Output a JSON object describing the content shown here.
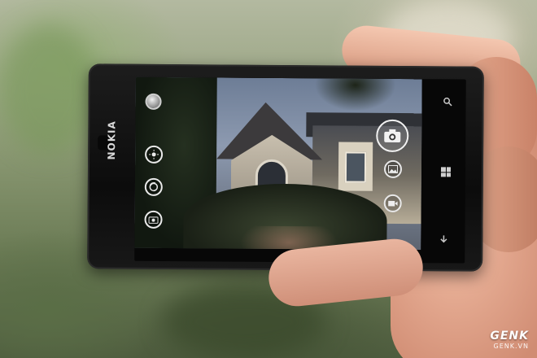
{
  "phone": {
    "brand": "NOKIA"
  },
  "camera_ui": {
    "left_controls": [
      {
        "name": "flash-indicator",
        "icon": "flash-icon"
      },
      {
        "name": "brightness-button",
        "icon": "brightness-icon"
      },
      {
        "name": "focus-button",
        "icon": "focus-icon"
      },
      {
        "name": "lens-button",
        "icon": "camera-lens-icon"
      }
    ],
    "right_controls": [
      {
        "name": "shutter-button",
        "icon": "camera-icon"
      },
      {
        "name": "photo-mode-button",
        "icon": "image-icon"
      },
      {
        "name": "video-mode-button",
        "icon": "video-icon"
      }
    ]
  },
  "nav_bar": {
    "search_icon": "search-icon",
    "start_icon": "windows-icon",
    "back_icon": "back-arrow-icon"
  },
  "watermark": {
    "brand": "GENK",
    "domain": "GENK.VN"
  }
}
